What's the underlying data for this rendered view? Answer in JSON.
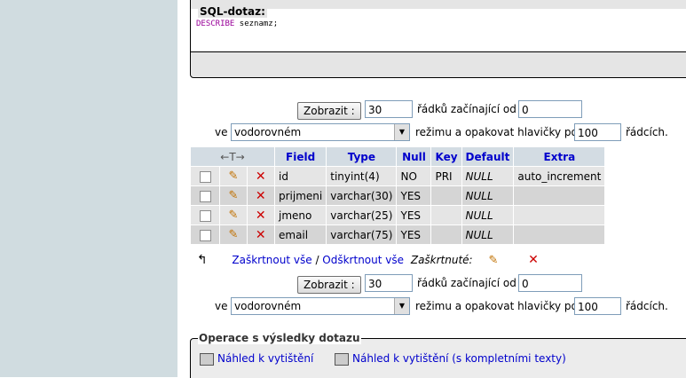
{
  "sql": {
    "legend": "SQL-dotaz:",
    "keyword": "DESCRIBE",
    "query_rest": " seznamz;"
  },
  "nav_top": {
    "show_button": "Zobrazit :",
    "rows_value": "30",
    "rows_from_label": "řádků začínající od",
    "start_value": "0",
    "in_label": "ve",
    "mode_selected": "vodorovném",
    "repeat_label": "režimu a opakovat hlavičky po",
    "repeat_value": "100",
    "rows_suffix": "řádcích."
  },
  "nav_bottom": {
    "show_button": "Zobrazit :",
    "rows_value": "30",
    "rows_from_label": "řádků začínající od",
    "start_value": "0",
    "in_label": "ve",
    "mode_selected": "vodorovném",
    "repeat_label": "režimu a opakovat hlavičky po",
    "repeat_value": "100",
    "rows_suffix": "řádcích."
  },
  "table": {
    "arrows_header": "←T→",
    "columns": [
      "Field",
      "Type",
      "Null",
      "Key",
      "Default",
      "Extra"
    ],
    "rows": [
      {
        "field": "id",
        "type": "tinyint(4)",
        "null": "NO",
        "key": "PRI",
        "default": "NULL",
        "extra": "auto_increment"
      },
      {
        "field": "prijmeni",
        "type": "varchar(30)",
        "null": "YES",
        "key": "",
        "default": "NULL",
        "extra": ""
      },
      {
        "field": "jmeno",
        "type": "varchar(25)",
        "null": "YES",
        "key": "",
        "default": "NULL",
        "extra": ""
      },
      {
        "field": "email",
        "type": "varchar(75)",
        "null": "YES",
        "key": "",
        "default": "NULL",
        "extra": ""
      }
    ]
  },
  "check": {
    "check_all": "Zaškrtnout vše",
    "separator": " / ",
    "uncheck_all": "Odškrtnout vše",
    "with_selected": "Zaškrtnuté:"
  },
  "ops": {
    "legend": "Operace s výsledky dotazu",
    "print_view": "Náhled k vytištění",
    "print_view_full": "Náhled k vytištění (s kompletními texty)"
  },
  "colors": {
    "sidebar": "#d0dce0",
    "header_bg": "#d3dce3",
    "row_odd": "#e5e5e5",
    "row_even": "#d5d5d5",
    "link": "#0000cc"
  }
}
